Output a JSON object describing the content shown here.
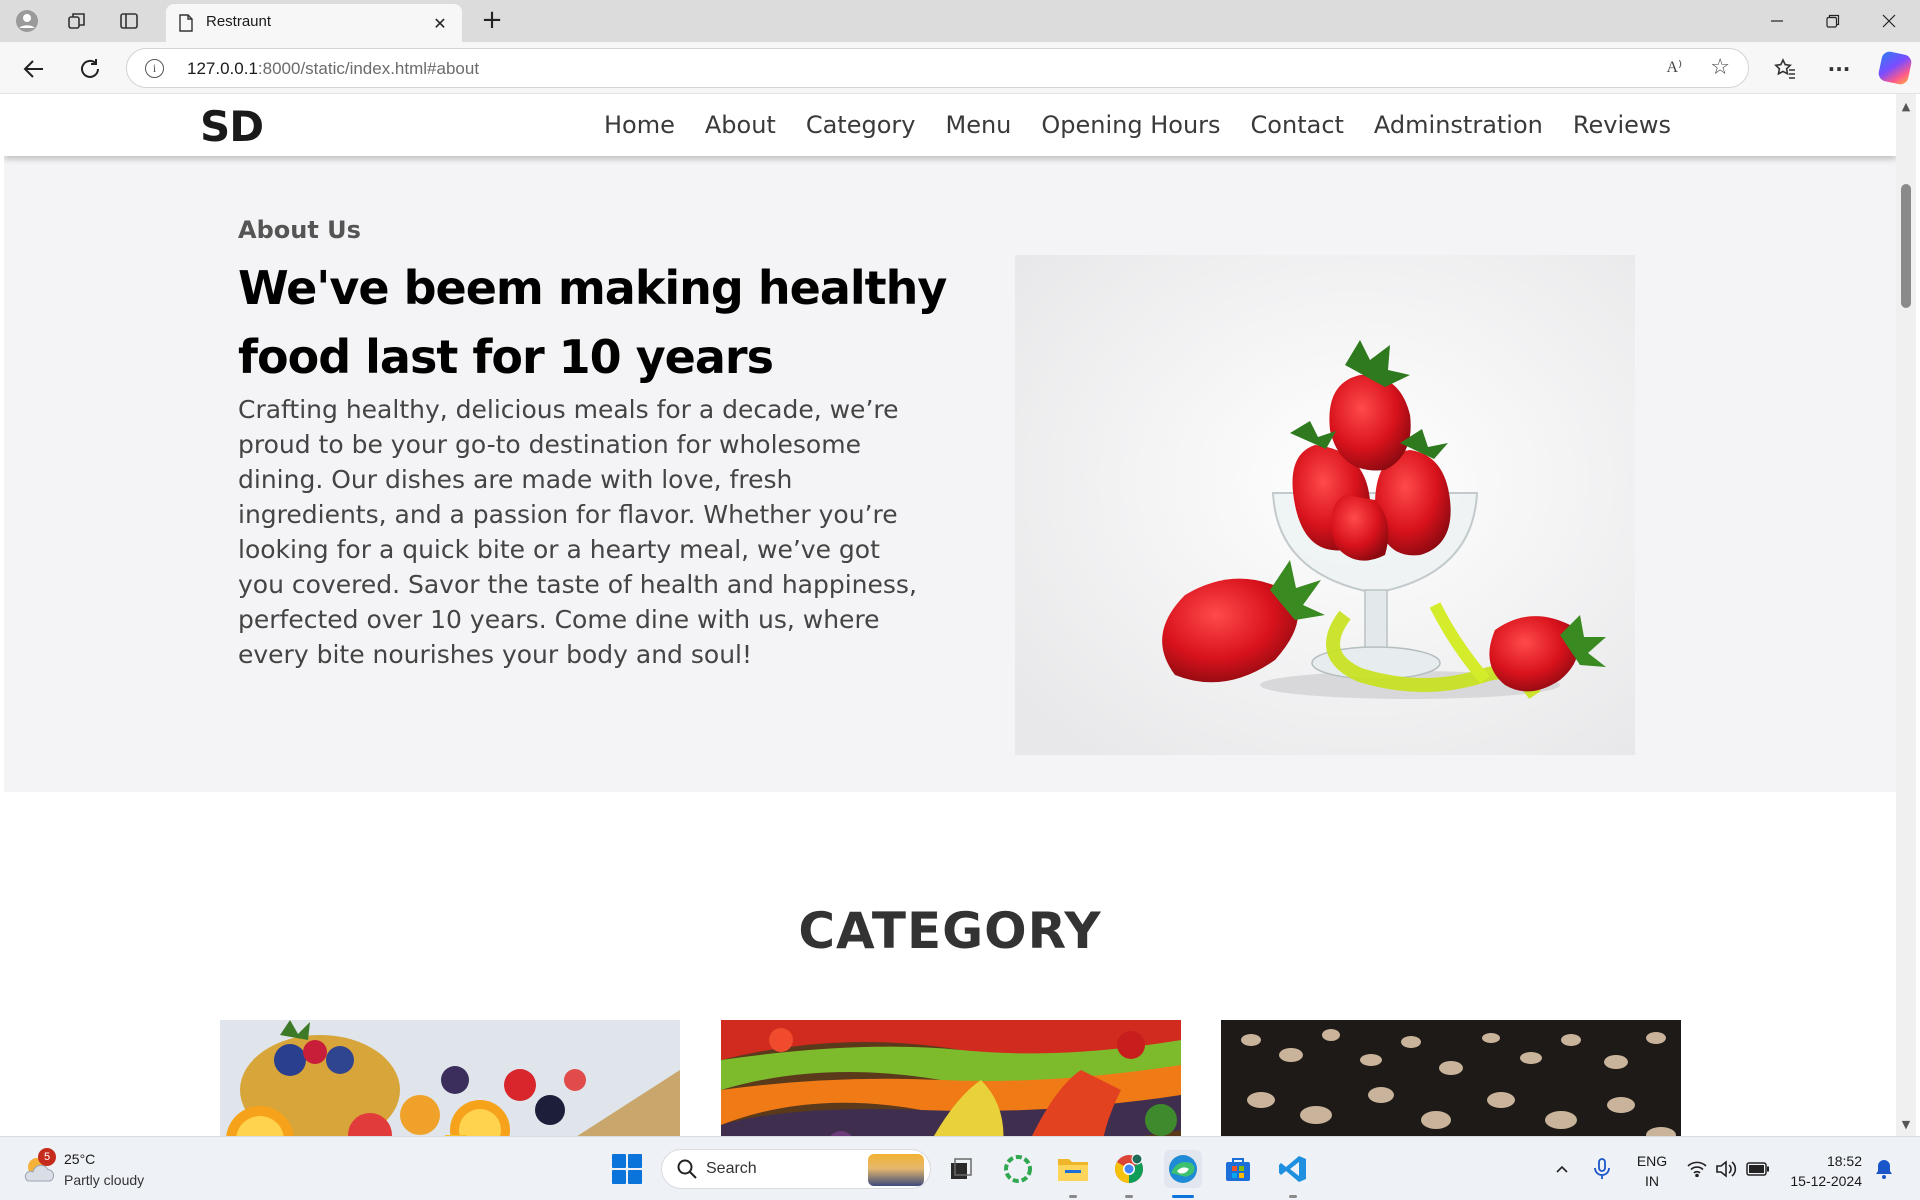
{
  "browser": {
    "tab_title": "Restraunt",
    "url_host": "127.0.0.1",
    "url_rest": ":8000/static/index.html#about",
    "read_aloud_glyph": "A⁾",
    "new_tab_glyph": "+",
    "close_glyph": "✕",
    "more_glyph": "···"
  },
  "site": {
    "logo": "SD",
    "nav": [
      "Home",
      "About",
      "Category",
      "Menu",
      "Opening Hours",
      "Contact",
      "Adminstration",
      "Reviews"
    ],
    "about": {
      "subtitle": "About Us",
      "title": "We've beem making healthy food last for 10 years",
      "body": "Crafting healthy, delicious meals for a decade, we’re proud to be your go-to destination for wholesome dining. Our dishes are made with love, fresh ingredients, and a passion for flavor. Whether you’re looking for a quick bite or a hearty meal, we’ve got you covered. Savor the taste of health and happiness, perfected over 10 years. Come dine with us, where every bite nourishes your body and soul!"
    },
    "category": {
      "title": "CATEGORY"
    }
  },
  "taskbar": {
    "weather_badge": "5",
    "weather_temp": "25°C",
    "weather_desc": "Partly cloudy",
    "search_label": "Search",
    "lang_top": "ENG",
    "lang_bottom": "IN",
    "time": "18:52",
    "date": "15-12-2024"
  },
  "colors": {
    "accent": "#0a74da",
    "about_bg": "#f4f4f6",
    "heading": "#000000"
  }
}
